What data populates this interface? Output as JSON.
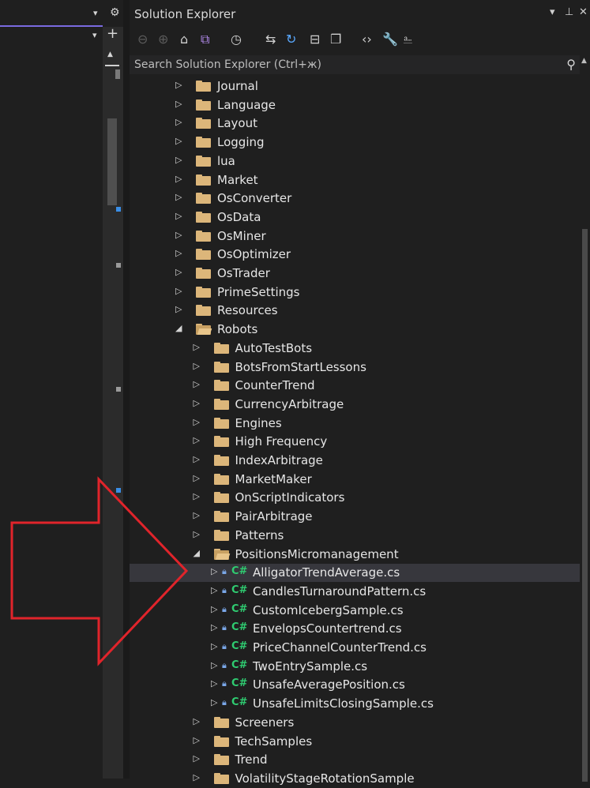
{
  "window": {
    "title": "Solution Explorer",
    "title_buttons": [
      "▾",
      "⊥",
      "✕"
    ],
    "search_placeholder": "Search Solution Explorer (Ctrl+ж)"
  },
  "left_pane": {
    "top_icons": [
      "▾",
      "⚙"
    ],
    "dropdown_caret": "▾",
    "split_icon": "+",
    "scroll_up": "▲"
  },
  "toolbar": {
    "icons": [
      "back-icon",
      "forward-icon",
      "home-icon",
      "switch-views-icon",
      "history-icon",
      "sync-icon",
      "refresh-icon",
      "collapse-all-icon",
      "show-all-files-icon",
      "view-code-icon",
      "properties-icon",
      "preview-icon"
    ]
  },
  "tree": [
    {
      "label": "Journal",
      "type": "folder",
      "depth": 0,
      "expanded": false
    },
    {
      "label": "Language",
      "type": "folder",
      "depth": 0,
      "expanded": false
    },
    {
      "label": "Layout",
      "type": "folder",
      "depth": 0,
      "expanded": false
    },
    {
      "label": "Logging",
      "type": "folder",
      "depth": 0,
      "expanded": false
    },
    {
      "label": "lua",
      "type": "folder",
      "depth": 0,
      "expanded": false
    },
    {
      "label": "Market",
      "type": "folder",
      "depth": 0,
      "expanded": false
    },
    {
      "label": "OsConverter",
      "type": "folder",
      "depth": 0,
      "expanded": false
    },
    {
      "label": "OsData",
      "type": "folder",
      "depth": 0,
      "expanded": false
    },
    {
      "label": "OsMiner",
      "type": "folder",
      "depth": 0,
      "expanded": false
    },
    {
      "label": "OsOptimizer",
      "type": "folder",
      "depth": 0,
      "expanded": false
    },
    {
      "label": "OsTrader",
      "type": "folder",
      "depth": 0,
      "expanded": false
    },
    {
      "label": "PrimeSettings",
      "type": "folder",
      "depth": 0,
      "expanded": false
    },
    {
      "label": "Resources",
      "type": "folder",
      "depth": 0,
      "expanded": false
    },
    {
      "label": "Robots",
      "type": "folder",
      "depth": 0,
      "expanded": true
    },
    {
      "label": "AutoTestBots",
      "type": "folder",
      "depth": 1,
      "expanded": false
    },
    {
      "label": "BotsFromStartLessons",
      "type": "folder",
      "depth": 1,
      "expanded": false
    },
    {
      "label": "CounterTrend",
      "type": "folder",
      "depth": 1,
      "expanded": false
    },
    {
      "label": "CurrencyArbitrage",
      "type": "folder",
      "depth": 1,
      "expanded": false
    },
    {
      "label": "Engines",
      "type": "folder",
      "depth": 1,
      "expanded": false
    },
    {
      "label": "High Frequency",
      "type": "folder",
      "depth": 1,
      "expanded": false
    },
    {
      "label": "IndexArbitrage",
      "type": "folder",
      "depth": 1,
      "expanded": false
    },
    {
      "label": "MarketMaker",
      "type": "folder",
      "depth": 1,
      "expanded": false
    },
    {
      "label": "OnScriptIndicators",
      "type": "folder",
      "depth": 1,
      "expanded": false
    },
    {
      "label": "PairArbitrage",
      "type": "folder",
      "depth": 1,
      "expanded": false
    },
    {
      "label": "Patterns",
      "type": "folder",
      "depth": 1,
      "expanded": false
    },
    {
      "label": "PositionsMicromanagement",
      "type": "folder",
      "depth": 1,
      "expanded": true
    },
    {
      "label": "AlligatorTrendAverage.cs",
      "type": "cs",
      "depth": 2,
      "expanded": false,
      "selected": true
    },
    {
      "label": "CandlesTurnaroundPattern.cs",
      "type": "cs",
      "depth": 2,
      "expanded": false
    },
    {
      "label": "CustomIcebergSample.cs",
      "type": "cs",
      "depth": 2,
      "expanded": false
    },
    {
      "label": "EnvelopsCountertrend.cs",
      "type": "cs",
      "depth": 2,
      "expanded": false
    },
    {
      "label": "PriceChannelCounterTrend.cs",
      "type": "cs",
      "depth": 2,
      "expanded": false
    },
    {
      "label": "TwoEntrySample.cs",
      "type": "cs",
      "depth": 2,
      "expanded": false
    },
    {
      "label": "UnsafeAveragePosition.cs",
      "type": "cs",
      "depth": 2,
      "expanded": false
    },
    {
      "label": "UnsafeLimitsClosingSample.cs",
      "type": "cs",
      "depth": 2,
      "expanded": false
    },
    {
      "label": "Screeners",
      "type": "folder",
      "depth": 1,
      "expanded": false
    },
    {
      "label": "TechSamples",
      "type": "folder",
      "depth": 1,
      "expanded": false
    },
    {
      "label": "Trend",
      "type": "folder",
      "depth": 1,
      "expanded": false
    },
    {
      "label": "VolatilityStageRotationSample",
      "type": "folder",
      "depth": 1,
      "expanded": false
    }
  ],
  "cs_tag": "C#",
  "colors": {
    "folder": "#dcb67a",
    "cs_glyph": "#2fcc71",
    "lock": "#7aa7e8",
    "annotation_arrow": "#e0242b",
    "selection": "#37373d"
  }
}
